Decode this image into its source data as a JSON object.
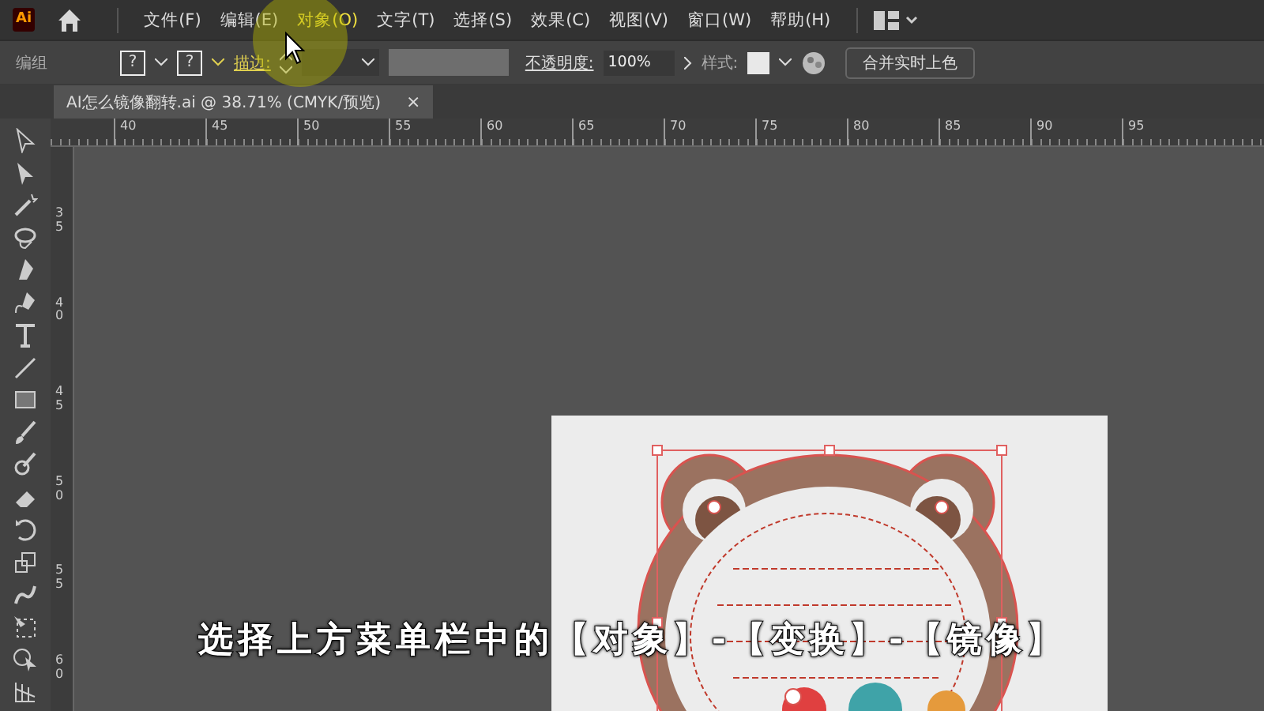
{
  "app": {
    "logo": "Ai"
  },
  "menu_bar": {
    "items": [
      {
        "label": "文件(F)",
        "selected": false
      },
      {
        "label": "编辑(E)",
        "selected": false
      },
      {
        "label": "对象(O)",
        "selected": true
      },
      {
        "label": "文字(T)",
        "selected": false
      },
      {
        "label": "选择(S)",
        "selected": false
      },
      {
        "label": "效果(C)",
        "selected": false
      },
      {
        "label": "视图(V)",
        "selected": false
      },
      {
        "label": "窗口(W)",
        "selected": false
      },
      {
        "label": "帮助(H)",
        "selected": false
      }
    ]
  },
  "control_bar": {
    "selection_label": "编组",
    "fill_swatch": "?",
    "stroke_swatch": "?",
    "stroke_label": "描边:",
    "opacity_label": "不透明度:",
    "opacity_value": "100%",
    "style_label": "样式:",
    "live_paint_button": "合并实时上色"
  },
  "document_tab": {
    "title": "AI怎么镜像翻转.ai @ 38.71% (CMYK/预览)",
    "close": "×"
  },
  "horizontal_ruler": {
    "labels": [
      "40",
      "45",
      "50",
      "55",
      "60",
      "65",
      "70",
      "75",
      "80",
      "85",
      "90",
      "95"
    ]
  },
  "vertical_ruler": {
    "labels": [
      "35",
      "40",
      "45",
      "50",
      "55",
      "60"
    ]
  },
  "subtitle": "选择上方菜单栏中的【对象】-【变换】-【镜像】"
}
